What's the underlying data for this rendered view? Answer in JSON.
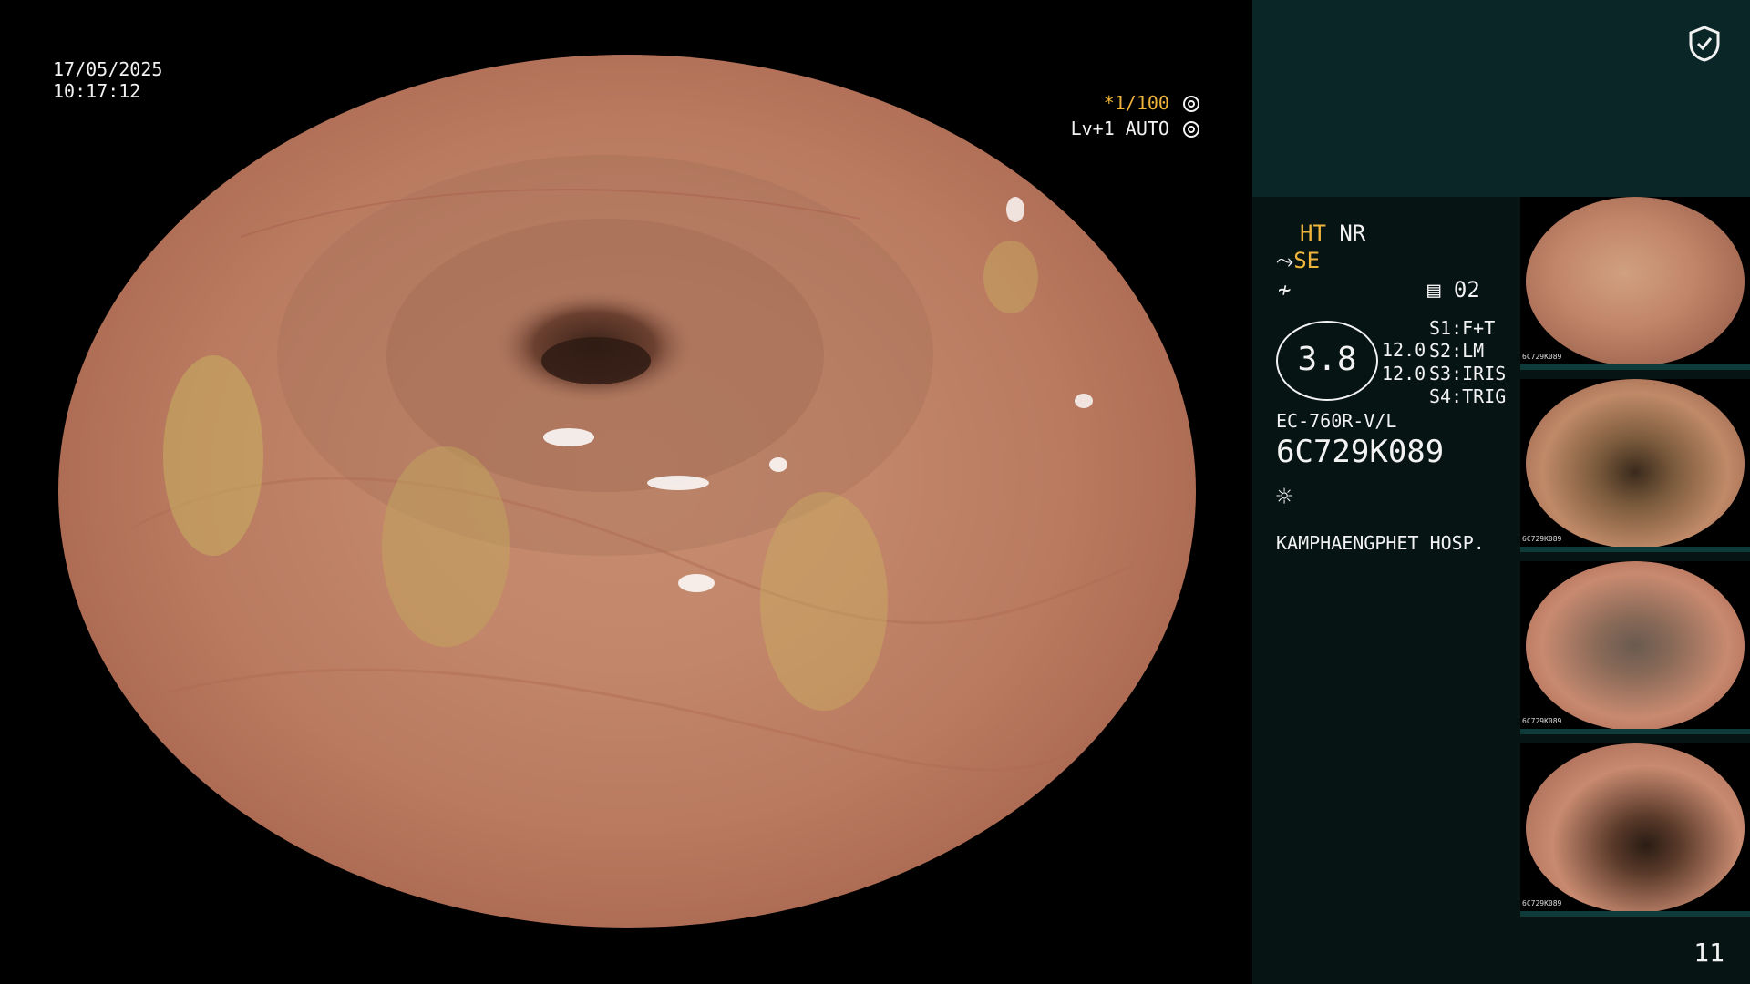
{
  "overlay": {
    "date": "17/05/2025",
    "time": "10:17:12",
    "shutter": "*1/100",
    "level": "Lv+1 AUTO"
  },
  "panel": {
    "ht": "HT",
    "nr": "NR",
    "se": "SE",
    "memory_slot": "02",
    "gauge_value": "3.8",
    "value_a": "12.0",
    "value_b": "12.0",
    "switches": [
      "S1:F+T",
      "S2:LM",
      "S3:IRIS",
      "S4:TRIG"
    ],
    "scope_model": "EC-760R-V/L",
    "scope_serial": "6C729K089",
    "hospital": "KAMPHAENGPHET HOSP.",
    "page_number": "11"
  },
  "thumbnails": [
    {
      "serial": "6C729K089"
    },
    {
      "serial": "6C729K089"
    },
    {
      "serial": "6C729K089"
    },
    {
      "serial": "6C729K089"
    }
  ],
  "colors": {
    "panel_bg": "#061414",
    "panel_header_bg": "#0b2626",
    "accent_amber": "#f0b43a",
    "text": "#f2f2f2"
  }
}
